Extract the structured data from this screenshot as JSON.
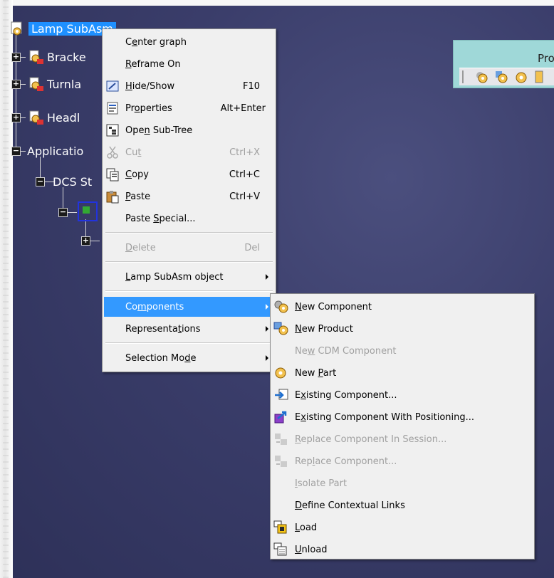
{
  "tree": {
    "root_label": "Lamp SubAsm",
    "nodes": [
      {
        "label": "Bracke"
      },
      {
        "label": "Turnla"
      },
      {
        "label": "Headl"
      },
      {
        "label": "Applicatio"
      },
      {
        "label": "DCS St"
      }
    ]
  },
  "toolbar": {
    "title": "Pro",
    "icons": [
      "new-component-icon",
      "new-product-icon",
      "new-part-icon",
      "more-icon"
    ]
  },
  "context_menu": {
    "items": [
      {
        "pre": "C",
        "u": "e",
        "post": "nter graph",
        "shortcut": "",
        "icon": ""
      },
      {
        "pre": "",
        "u": "R",
        "post": "eframe On",
        "shortcut": "",
        "icon": ""
      },
      {
        "pre": "",
        "u": "H",
        "post": "ide/Show",
        "shortcut": "F10",
        "icon": "hide-show-icon"
      },
      {
        "pre": "Pr",
        "u": "o",
        "post": "perties",
        "shortcut": "Alt+Enter",
        "icon": "properties-icon"
      },
      {
        "pre": "Ope",
        "u": "n",
        "post": " Sub-Tree",
        "shortcut": "",
        "icon": "open-subtree-icon"
      },
      {
        "pre": "Cu",
        "u": "t",
        "post": "",
        "shortcut": "Ctrl+X",
        "icon": "cut-icon"
      },
      {
        "pre": "",
        "u": "C",
        "post": "opy",
        "shortcut": "Ctrl+C",
        "icon": "copy-icon"
      },
      {
        "pre": "",
        "u": "P",
        "post": "aste",
        "shortcut": "Ctrl+V",
        "icon": "paste-icon"
      },
      {
        "pre": "Paste ",
        "u": "S",
        "post": "pecial...",
        "shortcut": "",
        "icon": ""
      },
      {
        "pre": "",
        "u": "D",
        "post": "elete",
        "shortcut": "Del",
        "icon": ""
      },
      {
        "pre": "",
        "u": "L",
        "post": "amp SubAsm object",
        "shortcut": "",
        "icon": ""
      },
      {
        "pre": "Co",
        "u": "m",
        "post": "ponents",
        "shortcut": "",
        "icon": ""
      },
      {
        "pre": "Representa",
        "u": "t",
        "post": "ions",
        "shortcut": "",
        "icon": ""
      },
      {
        "pre": "Selection Mo",
        "u": "d",
        "post": "e",
        "shortcut": "",
        "icon": ""
      }
    ]
  },
  "components_submenu": {
    "items": [
      {
        "pre": "",
        "u": "N",
        "post": "ew Component"
      },
      {
        "pre": "",
        "u": "N",
        "post": "ew Product"
      },
      {
        "pre": "Ne",
        "u": "w",
        "post": " CDM Component"
      },
      {
        "pre": "New ",
        "u": "P",
        "post": "art"
      },
      {
        "pre": "E",
        "u": "x",
        "post": "isting Component..."
      },
      {
        "pre": "E",
        "u": "x",
        "post": "isting Component With Positioning..."
      },
      {
        "pre": "",
        "u": "R",
        "post": "eplace Component In Session..."
      },
      {
        "pre": "Rep",
        "u": "l",
        "post": "ace Component..."
      },
      {
        "pre": "",
        "u": "I",
        "post": "solate Part"
      },
      {
        "pre": "",
        "u": "D",
        "post": "efine Contextual Links"
      },
      {
        "pre": "",
        "u": "L",
        "post": "oad"
      },
      {
        "pre": "",
        "u": "U",
        "post": "nload"
      }
    ]
  },
  "colors": {
    "viewport_bg": "#3a3d6a",
    "menu_highlight": "#3399ff",
    "tree_selection": "#1e90ff",
    "toolbar_bg": "#9fd8d8"
  }
}
